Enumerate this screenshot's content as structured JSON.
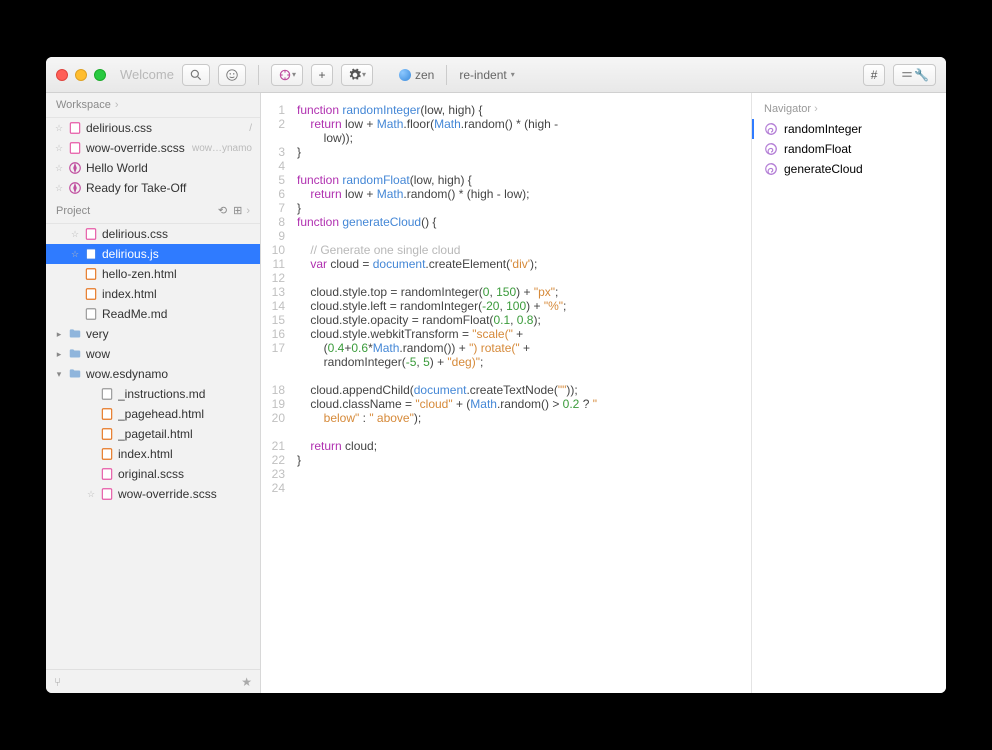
{
  "titlebar": {
    "window_title": "Welcome",
    "zen_label": "zen",
    "reindent_label": "re-indent"
  },
  "sidebar": {
    "workspace_label": "Workspace",
    "project_label": "Project",
    "workspace_items": [
      {
        "icon": "css",
        "name": "delirious.css",
        "meta": "/"
      },
      {
        "icon": "scss",
        "name": "wow-override.scss",
        "meta": "wow…ynamo"
      },
      {
        "icon": "compass",
        "name": "Hello World",
        "meta": ""
      },
      {
        "icon": "compass",
        "name": "Ready for Take-Off",
        "meta": ""
      }
    ],
    "project_items": [
      {
        "icon": "css",
        "name": "delirious.css",
        "star": true,
        "indent": 1
      },
      {
        "icon": "js",
        "name": "delirious.js",
        "star": true,
        "indent": 1,
        "selected": true
      },
      {
        "icon": "html",
        "name": "hello-zen.html",
        "indent": 1
      },
      {
        "icon": "html",
        "name": "index.html",
        "indent": 1
      },
      {
        "icon": "md",
        "name": "ReadMe.md",
        "indent": 1
      },
      {
        "icon": "folder",
        "name": "very",
        "indent": 0,
        "disclosure": "▸"
      },
      {
        "icon": "folder",
        "name": "wow",
        "indent": 0,
        "disclosure": "▸"
      },
      {
        "icon": "folder",
        "name": "wow.esdynamo",
        "indent": 0,
        "disclosure": "▾"
      },
      {
        "icon": "md",
        "name": "_instructions.md",
        "indent": 2
      },
      {
        "icon": "html",
        "name": "_pagehead.html",
        "indent": 2
      },
      {
        "icon": "html",
        "name": "_pagetail.html",
        "indent": 2
      },
      {
        "icon": "html",
        "name": "index.html",
        "indent": 2
      },
      {
        "icon": "scss",
        "name": "original.scss",
        "indent": 2
      },
      {
        "icon": "scss",
        "name": "wow-override.scss",
        "star": true,
        "indent": 2
      }
    ]
  },
  "editor": {
    "line_count": 24,
    "code_html": "<span class='kw'>function</span> <span class='fn'>randomInteger</span>(low, high) {\n    <span class='kw'>return</span> low + <span class='id'>Math</span>.floor(<span class='id'>Math</span>.random() * (high -\n        low));\n}\n\n<span class='kw'>function</span> <span class='fn'>randomFloat</span>(low, high) {\n    <span class='kw'>return</span> low + <span class='id'>Math</span>.random() * (high - low);\n}\n<span class='kw'>function</span> <span class='fn'>generateCloud</span>() {\n\n    <span class='com'>// Generate one single cloud</span>\n    <span class='kw'>var</span> cloud = <span class='id'>document</span>.createElement(<span class='str'>'div'</span>);\n\n    cloud.style.top = randomInteger(<span class='num'>0</span>, <span class='num'>150</span>) + <span class='str'>\"px\"</span>;\n    cloud.style.left = randomInteger(<span class='num'>-20</span>, <span class='num'>100</span>) + <span class='str'>\"%\"</span>;\n    cloud.style.opacity = randomFloat(<span class='num'>0.1</span>, <span class='num'>0.8</span>);\n    cloud.style.webkitTransform = <span class='str'>\"scale(\"</span> +\n        (<span class='num'>0.4</span>+<span class='num'>0.6</span>*<span class='id'>Math</span>.random()) + <span class='str'>\") rotate(\"</span> +\n        randomInteger(<span class='num'>-5</span>, <span class='num'>5</span>) + <span class='str'>\"deg)\"</span>;\n\n    cloud.appendChild(<span class='id'>document</span>.createTextNode(<span class='str'>\"\"</span>));\n    cloud.className = <span class='str'>\"cloud\"</span> + (<span class='id'>Math</span>.random() > <span class='num'>0.2</span> ? <span class='str'>\"\n        below\"</span> : <span class='str'>\" above\"</span>);\n\n    <span class='kw'>return</span> cloud;\n}\n"
  },
  "navigator": {
    "label": "Navigator",
    "items": [
      {
        "name": "randomInteger",
        "active": true
      },
      {
        "name": "randomFloat"
      },
      {
        "name": "generateCloud"
      }
    ]
  }
}
